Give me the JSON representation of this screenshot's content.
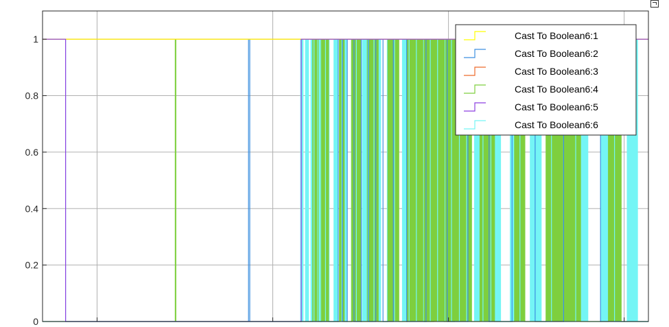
{
  "chart_data": {
    "type": "line",
    "title": "",
    "xlabel": "",
    "ylabel": "",
    "ylim": [
      0,
      1.1
    ],
    "yticks": [
      "0",
      "0.2",
      "0.4",
      "0.6",
      "0.8",
      "1"
    ],
    "ytick_values": [
      0,
      0.2,
      0.4,
      0.6,
      0.8,
      1
    ],
    "xlim": [
      0,
      100
    ],
    "xticks": [
      9,
      38,
      67,
      96
    ],
    "xtick_labels": [],
    "grid": true,
    "legend_position": "top-right",
    "background": "#ffffff",
    "series": [
      {
        "name": "Cast To Boolean6:1",
        "color": "#ffff00",
        "x": [
          0,
          100
        ],
        "y": [
          1,
          1
        ]
      },
      {
        "name": "Cast To Boolean6:2",
        "color": "#3d8fe0",
        "x": [
          0,
          34,
          34,
          34.2,
          34.2,
          48.8,
          48.8,
          49.5,
          49.5,
          50.3,
          50.3,
          51.4,
          51.4,
          52.6,
          52.6,
          53.8,
          53.8,
          55.0,
          55.0,
          56.2,
          56.2,
          57.9,
          57.9,
          60.1,
          60.1,
          63.3,
          63.3,
          66.8,
          66.8,
          70.2,
          70.2,
          73.7,
          73.7,
          77.5,
          77.5,
          81.3,
          81.3,
          86.0,
          86.0,
          92.1,
          92.1,
          100
        ],
        "y": [
          0,
          0,
          1,
          1,
          0,
          0,
          1,
          1,
          0,
          0,
          1,
          1,
          0,
          0,
          1,
          1,
          0,
          0,
          1,
          1,
          0,
          0,
          1,
          1,
          0,
          0,
          1,
          1,
          0,
          0,
          1,
          1,
          0,
          0,
          1,
          1,
          0,
          0,
          1,
          1,
          0,
          0
        ]
      },
      {
        "name": "Cast To Boolean6:3",
        "color": "#ee6a2a",
        "x": [
          0,
          100
        ],
        "y": [
          1,
          1
        ]
      },
      {
        "name": "Cast To Boolean6:4",
        "color": "#7ecf3e",
        "x": [
          0,
          21.9,
          21.9,
          22.0,
          22.0,
          44.6,
          44.6,
          45.5,
          45.5,
          46.0,
          46.0,
          47.2,
          47.2,
          49.0,
          49.0,
          49.8,
          49.8,
          51.0,
          51.0,
          52.5,
          52.5,
          53.6,
          53.6,
          55.4,
          55.4,
          57.0,
          57.0,
          58.8,
          58.8,
          60.2,
          60.2,
          63.0,
          63.0,
          64.6,
          64.6,
          66.3,
          66.3,
          68.0,
          68.0,
          70.8,
          70.8,
          72.2,
          72.2,
          74.6,
          74.6,
          77.9,
          77.9,
          79.6,
          79.6,
          83.1,
          83.1,
          88.8,
          88.8,
          93.4,
          93.4,
          95.5,
          95.5,
          100
        ],
        "y": [
          0,
          0,
          1,
          1,
          0,
          0,
          1,
          1,
          0,
          0,
          1,
          1,
          0,
          0,
          1,
          1,
          0,
          0,
          1,
          1,
          0,
          0,
          1,
          1,
          0,
          0,
          1,
          1,
          0,
          0,
          1,
          1,
          0,
          0,
          1,
          1,
          0,
          0,
          1,
          1,
          0,
          0,
          1,
          1,
          0,
          0,
          1,
          1,
          0,
          0,
          1,
          1,
          0,
          0,
          1,
          1,
          0,
          0
        ]
      },
      {
        "name": "Cast To Boolean6:5",
        "color": "#8c3fe0",
        "x": [
          0,
          3.8,
          3.8,
          42.7,
          42.7,
          100
        ],
        "y": [
          1,
          1,
          0,
          0,
          1,
          1
        ]
      },
      {
        "name": "Cast To Boolean6:6",
        "color": "#74f5f5",
        "x": [
          0,
          3.8,
          3.8,
          42.6,
          42.6,
          43.0,
          43.0,
          43.4,
          43.4,
          43.9,
          43.9,
          44.3,
          44.3,
          44.8,
          44.8,
          45.4,
          45.4,
          46.0,
          46.0,
          46.7,
          46.7,
          47.3,
          47.3,
          48.1,
          48.1,
          48.7,
          48.7,
          49.4,
          49.4,
          50.2,
          50.2,
          51.0,
          51.0,
          51.8,
          51.8,
          52.8,
          52.8,
          53.7,
          53.7,
          54.7,
          54.7,
          55.8,
          55.8,
          56.9,
          56.9,
          58.1,
          58.1,
          59.4,
          59.4,
          60.5,
          60.5,
          61.7,
          61.7,
          62.9,
          62.9,
          64.0,
          64.0,
          65.2,
          65.2,
          66.4,
          66.4,
          67.5,
          67.5,
          68.8,
          68.8,
          70.0,
          70.0,
          71.3,
          71.3,
          72.7,
          72.7,
          74.0,
          74.0,
          75.6,
          75.6,
          77.2,
          77.2,
          78.8,
          78.8,
          80.5,
          80.5,
          82.3,
          82.3,
          84.0,
          84.0,
          86.0,
          86.0,
          88.0,
          88.0,
          90.0,
          90.0,
          92.2,
          92.2,
          94.4,
          94.4,
          96.5,
          96.5,
          98.2,
          98.2,
          100
        ],
        "y": [
          1,
          1,
          0,
          0,
          1,
          1,
          0,
          0,
          1,
          1,
          0,
          0,
          1,
          1,
          0,
          0,
          1,
          1,
          0,
          0,
          1,
          1,
          0,
          0,
          1,
          1,
          0,
          0,
          1,
          1,
          0,
          0,
          1,
          1,
          0,
          0,
          1,
          1,
          0,
          0,
          1,
          1,
          0,
          0,
          1,
          1,
          0,
          0,
          1,
          1,
          0,
          0,
          1,
          1,
          0,
          0,
          1,
          1,
          0,
          0,
          1,
          1,
          0,
          0,
          1,
          1,
          0,
          0,
          1,
          1,
          0,
          0,
          1,
          1,
          0,
          0,
          1,
          1,
          0,
          0,
          1,
          1,
          0,
          0,
          1,
          1,
          0,
          0,
          1,
          1,
          0,
          0,
          1,
          1,
          0,
          0,
          1,
          1,
          0,
          0
        ]
      }
    ]
  }
}
